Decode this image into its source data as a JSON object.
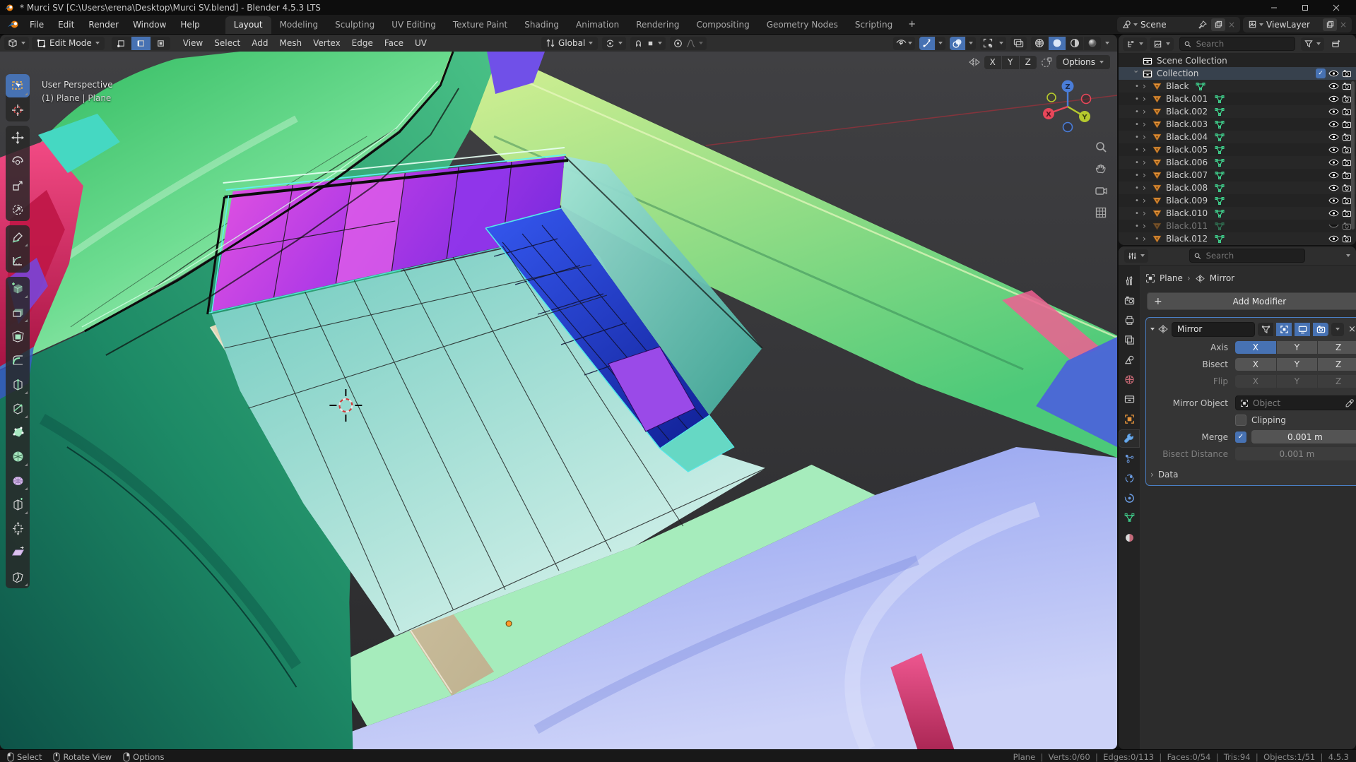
{
  "window": {
    "title": "* Murci SV [C:\\Users\\erena\\Desktop\\Murci SV.blend] - Blender 4.5.3 LTS"
  },
  "topbar": {
    "menus": [
      "File",
      "Edit",
      "Render",
      "Window",
      "Help"
    ],
    "workspaces": [
      {
        "label": "Layout",
        "active": true
      },
      {
        "label": "Modeling"
      },
      {
        "label": "Sculpting"
      },
      {
        "label": "UV Editing"
      },
      {
        "label": "Texture Paint"
      },
      {
        "label": "Shading"
      },
      {
        "label": "Animation"
      },
      {
        "label": "Rendering"
      },
      {
        "label": "Compositing"
      },
      {
        "label": "Geometry Nodes"
      },
      {
        "label": "Scripting"
      }
    ],
    "add_workspace_label": "+",
    "scene_label": "Scene",
    "view_layer_label": "ViewLayer"
  },
  "vheader": {
    "mode_label": "Edit Mode",
    "menus": [
      "View",
      "Select",
      "Add",
      "Mesh",
      "Vertex",
      "Edge",
      "Face",
      "UV"
    ],
    "orientation_label": "Global"
  },
  "tool_settings": {
    "axis": [
      "X",
      "Y",
      "Z"
    ],
    "options_label": "Options"
  },
  "viewport": {
    "view_label": "User Perspective",
    "object_label": "(1) Plane | Plane",
    "gizmo": {
      "x": "X",
      "y": "Y",
      "z": "Z"
    }
  },
  "toolbar": {
    "tools": [
      {
        "name": "select-box",
        "active": true
      },
      {
        "name": "cursor"
      },
      {
        "name": "move"
      },
      {
        "name": "rotate"
      },
      {
        "name": "scale"
      },
      {
        "name": "transform"
      },
      {
        "name": "annotate"
      },
      {
        "name": "measure"
      },
      {
        "name": "add-cube"
      },
      {
        "name": "extrude-region"
      },
      {
        "name": "inset-faces"
      },
      {
        "name": "bevel"
      },
      {
        "name": "loop-cut"
      },
      {
        "name": "knife"
      },
      {
        "name": "poly-build"
      },
      {
        "name": "spin"
      },
      {
        "name": "smooth"
      },
      {
        "name": "edge-slide"
      },
      {
        "name": "shrink-fatten"
      },
      {
        "name": "shear"
      },
      {
        "name": "rip-region"
      }
    ]
  },
  "outliner": {
    "search_placeholder": "Search",
    "scene_collection_label": "Scene Collection",
    "collection_label": "Collection",
    "objects": [
      {
        "name": "Black"
      },
      {
        "name": "Black.001"
      },
      {
        "name": "Black.002"
      },
      {
        "name": "Black.003"
      },
      {
        "name": "Black.004"
      },
      {
        "name": "Black.005"
      },
      {
        "name": "Black.006"
      },
      {
        "name": "Black.007"
      },
      {
        "name": "Black.008"
      },
      {
        "name": "Black.009"
      },
      {
        "name": "Black.010"
      },
      {
        "name": "Black.011",
        "hidden": true
      },
      {
        "name": "Black.012"
      }
    ]
  },
  "properties": {
    "search_placeholder": "Search",
    "breadcrumb_object": "Plane",
    "breadcrumb_modifier": "Mirror",
    "add_modifier_label": "Add Modifier",
    "active_tab": "modifiers",
    "tab_icons": [
      "tool",
      "render",
      "output",
      "view-layer",
      "scene",
      "world",
      "collection",
      "object",
      "modifiers",
      "particles",
      "physics",
      "constraints",
      "object-data",
      "material"
    ],
    "modifier": {
      "name": "Mirror",
      "axis_label": "Axis",
      "bisect_label": "Bisect",
      "flip_label": "Flip",
      "axis_options": [
        "X",
        "Y",
        "Z"
      ],
      "active_axis": "X",
      "mirror_object_label": "Mirror Object",
      "mirror_object_placeholder": "Object",
      "clipping_label": "Clipping",
      "clipping_checked": false,
      "merge_label": "Merge",
      "merge_checked": true,
      "merge_value": "0.001 m",
      "bisect_distance_label": "Bisect Distance",
      "bisect_distance_value": "0.001 m",
      "data_label": "Data"
    }
  },
  "statusbar": {
    "hints": [
      {
        "label": "Select",
        "button": "left"
      },
      {
        "label": "Rotate View",
        "button": "middle"
      },
      {
        "label": "Options",
        "button": "right"
      }
    ],
    "stats": [
      "Plane",
      "Verts:0/60",
      "Edges:0/113",
      "Faces:0/54",
      "Tris:94",
      "Objects:1/51",
      "4.5.3"
    ]
  },
  "colors": {
    "accent_blue": "#4772b3",
    "object_icon_orange": "#e8963c",
    "mesh_data_green": "#3fd08c",
    "axis_x": "#e8475a",
    "axis_y": "#b5c92e",
    "axis_z": "#4a7dd8"
  }
}
